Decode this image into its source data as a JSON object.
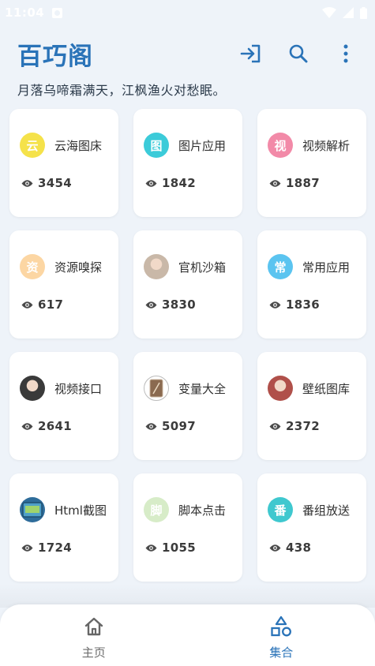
{
  "status": {
    "time": "11:04"
  },
  "app": {
    "title": "百巧阁",
    "subtitle": "月落乌啼霜满天，江枫渔火对愁眠。",
    "actions": [
      "login-icon",
      "search-icon",
      "more-vertical-icon"
    ]
  },
  "colors": {
    "accent": "#2a73b8",
    "background": "#eef3f9"
  },
  "cards": [
    {
      "label": "云海图床",
      "badge": "云",
      "color": "#f5e24a",
      "views": "3454"
    },
    {
      "label": "图片应用",
      "badge": "图",
      "color": "#3ccbd9",
      "views": "1842"
    },
    {
      "label": "视频解析",
      "badge": "视",
      "color": "#f28aa8",
      "views": "1887"
    },
    {
      "label": "资源嗅探",
      "badge": "资",
      "color": "#fcd6a3",
      "views": "617"
    },
    {
      "label": "官机沙箱",
      "badge": "",
      "color": "#c9b8a8",
      "views": "3830",
      "icon": "avatar-photo"
    },
    {
      "label": "常用应用",
      "badge": "常",
      "color": "#5bc4f0",
      "views": "1836"
    },
    {
      "label": "视频接口",
      "badge": "",
      "color": "#3a3a3a",
      "views": "2641",
      "icon": "avatar-photo"
    },
    {
      "label": "变量大全",
      "badge": "",
      "color": "#8a7a6a",
      "views": "5097",
      "icon": "card-photo"
    },
    {
      "label": "壁纸图库",
      "badge": "",
      "color": "#b0504a",
      "views": "2372",
      "icon": "avatar-photo"
    },
    {
      "label": "Html截图",
      "badge": "",
      "color": "#2e6c9a",
      "views": "1724",
      "icon": "screen-photo"
    },
    {
      "label": "脚本点击",
      "badge": "脚",
      "color": "#d7ecc8",
      "views": "1055"
    },
    {
      "label": "番组放送",
      "badge": "番",
      "color": "#3fc8cf",
      "views": "438"
    }
  ],
  "nav": {
    "home": {
      "label": "主页",
      "icon": "home-icon",
      "active": false
    },
    "collection": {
      "label": "集合",
      "icon": "shapes-icon",
      "active": true
    }
  }
}
